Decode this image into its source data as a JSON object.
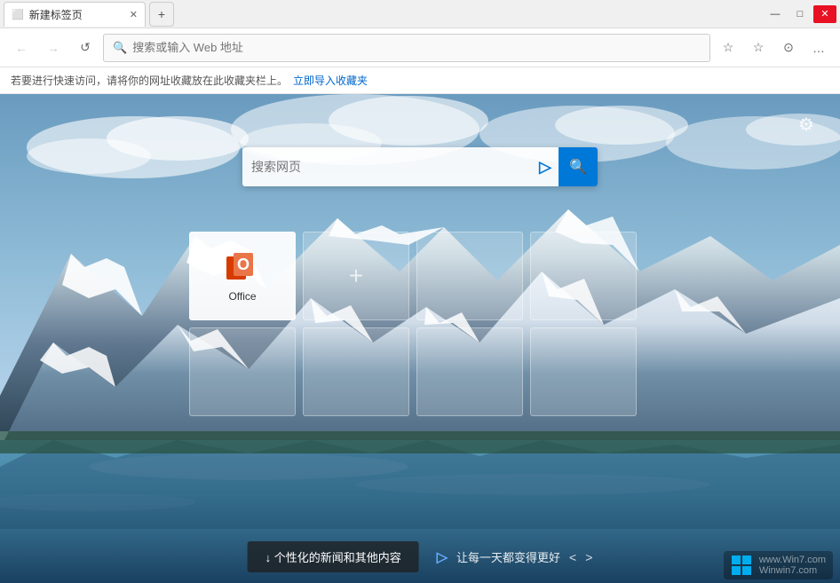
{
  "window": {
    "title": "新建标签页",
    "tab_new_label": "+",
    "controls": {
      "minimize": "—",
      "maximize": "□",
      "close": "✕"
    }
  },
  "nav": {
    "back_label": "←",
    "forward_label": "→",
    "refresh_label": "↺",
    "address_placeholder": "搜索或输入 Web 地址",
    "address_value": "",
    "favorites_icon": "☆",
    "hub_icon": "☆",
    "profile_icon": "○",
    "more_icon": "…"
  },
  "favbar": {
    "message": "若要进行快速访问，请将你的网址收藏放在此收藏夹栏上。",
    "link_text": "立即导入收藏夹"
  },
  "search": {
    "placeholder": "搜索网页"
  },
  "settings": {
    "icon": "⚙"
  },
  "tiles": [
    {
      "id": "office",
      "label": "Office",
      "type": "office"
    },
    {
      "id": "add",
      "label": "",
      "type": "add"
    },
    {
      "id": "empty1",
      "label": "",
      "type": "empty"
    },
    {
      "id": "empty2",
      "label": "",
      "type": "empty"
    },
    {
      "id": "empty3",
      "label": "",
      "type": "empty"
    },
    {
      "id": "empty4",
      "label": "",
      "type": "empty"
    },
    {
      "id": "empty5",
      "label": "",
      "type": "empty"
    },
    {
      "id": "empty6",
      "label": "",
      "type": "empty"
    }
  ],
  "bottom": {
    "news_btn": "↓ 个性化的新闻和其他内容",
    "motto": "让每一天都变得更好",
    "prev": "<",
    "next": ">"
  },
  "watermark": {
    "line1": "www.Win7.com",
    "line2": "Winwin7.com"
  }
}
